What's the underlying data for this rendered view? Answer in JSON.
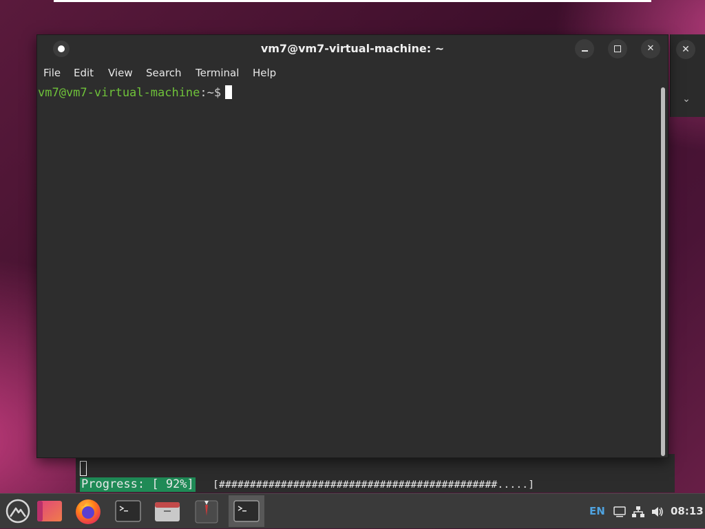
{
  "terminal": {
    "title": "vm7@vm7-virtual-machine: ~",
    "menu": [
      "File",
      "Edit",
      "View",
      "Search",
      "Terminal",
      "Help"
    ],
    "prompt_user_host": "vm7@vm7-virtual-machine",
    "prompt_path": ":~$"
  },
  "ghost_window": {
    "close_glyph": "✕",
    "dropdown_glyph": "⌄"
  },
  "background_terminal": {
    "progress_label": "Progress: [ 92%]",
    "progress_bar": "[#############################################.....]",
    "progress_percent": 92
  },
  "taskbar": {
    "apps": [
      "launcher-icon",
      "app-icon",
      "firefox-icon",
      "terminal-icon",
      "files-icon",
      "suitcase-icon",
      "terminal-icon"
    ],
    "tray": {
      "language": "EN",
      "clock": "08:13"
    }
  },
  "colors": {
    "prompt_green": "#6fc23a",
    "progress_bg": "#1f8a56",
    "lang_blue": "#4fa3e0"
  }
}
